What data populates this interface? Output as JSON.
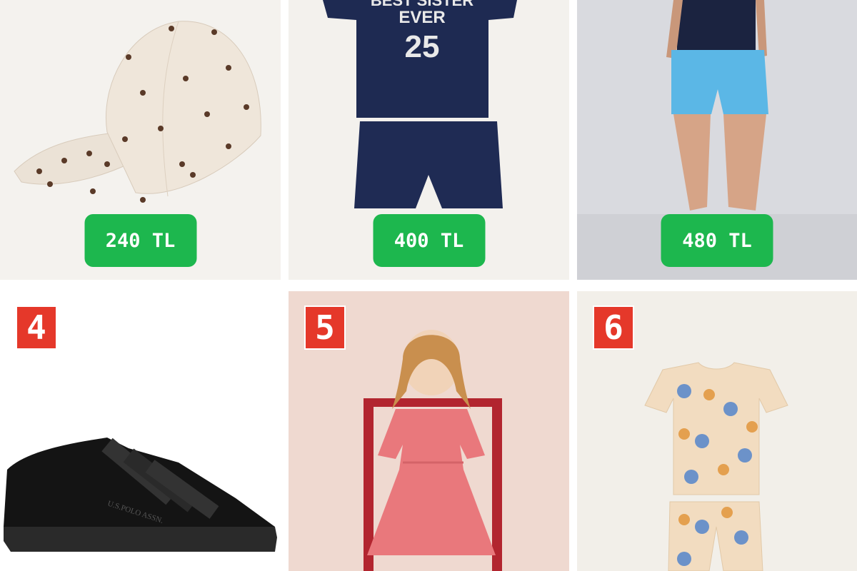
{
  "products": [
    {
      "id": "cap",
      "price": "240 TL",
      "image": "polka-dot-cap"
    },
    {
      "id": "kids-set",
      "price": "400 TL",
      "image": "navy-tee-shorts-set",
      "print": [
        "BEST SISTER",
        "EVER",
        "25"
      ]
    },
    {
      "id": "swim-shorts",
      "price": "480 TL",
      "image": "light-blue-shorts-model"
    },
    {
      "id": "sneaker",
      "number": "4",
      "image": "black-sneaker",
      "print": [
        "U.S.POLO ASSN."
      ]
    },
    {
      "id": "dress",
      "number": "5",
      "image": "girl-pink-dress"
    },
    {
      "id": "pajamas",
      "number": "6",
      "image": "dog-print-pajamas"
    }
  ],
  "colors": {
    "price_badge": "#1db74e",
    "number_badge": "#e5382a"
  }
}
